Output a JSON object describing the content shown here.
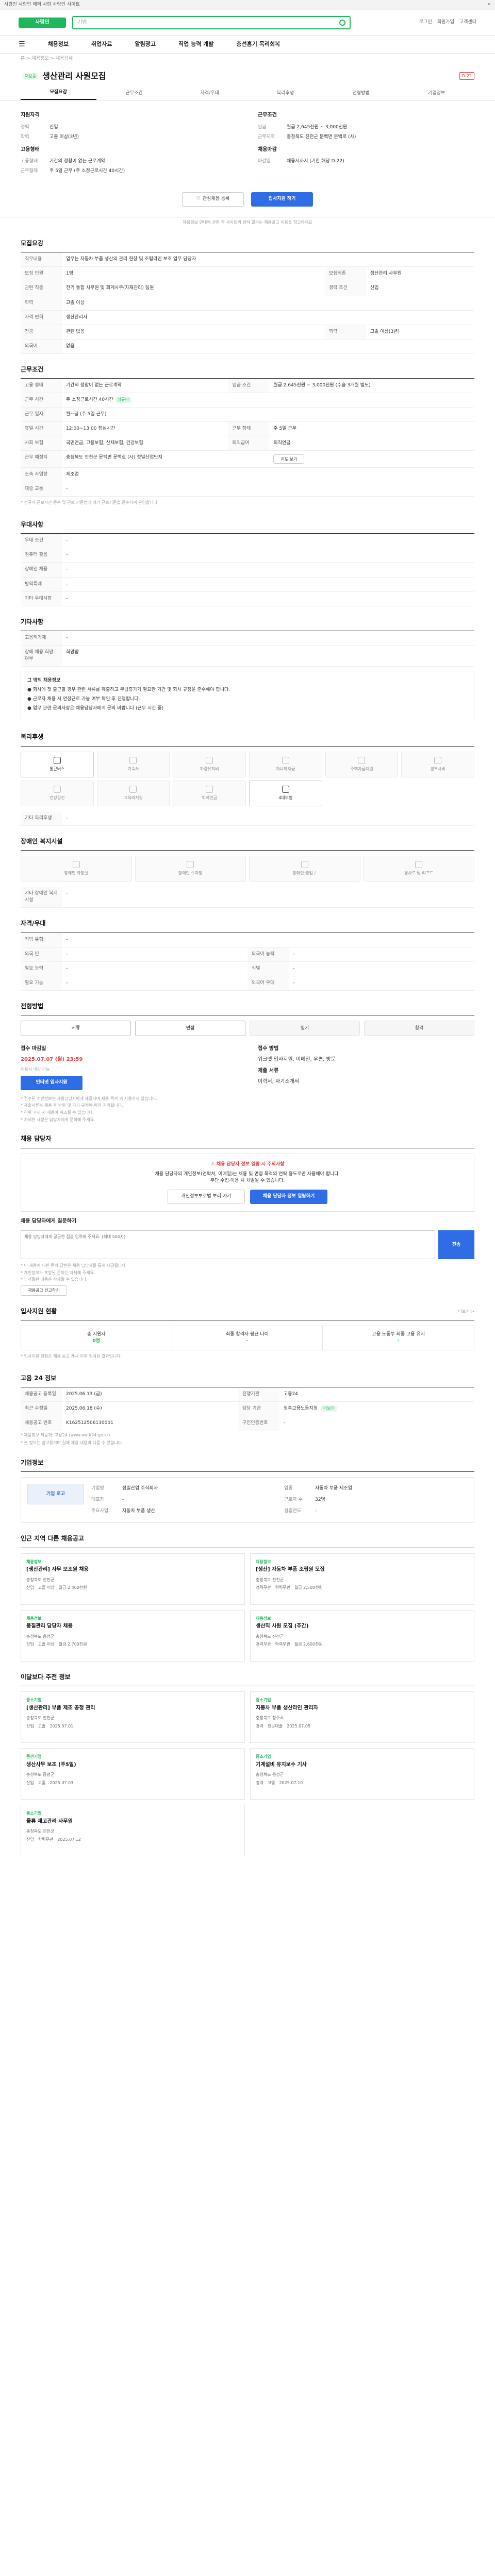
{
  "topbar": {
    "text": "사람인 사람인 해외 사람 사람인 사이트",
    "close": "✕"
  },
  "header": {
    "logo": "사람인",
    "search_placeholder": "기업",
    "links": [
      "로그인",
      "회원가입",
      "고객센터"
    ]
  },
  "nav": {
    "items": [
      "채용정보",
      "취업자료",
      "알림광고",
      "직업 능력 개발",
      "충선흥기 목리회복"
    ]
  },
  "crumb": "홈 > 채용정보 > 채용상세",
  "job": {
    "badge": "채용중",
    "title": "생산관리 사원모집",
    "tag": "D-22"
  },
  "tabs": [
    "모집요강",
    "근무조건",
    "자격/우대",
    "복리후생",
    "전형방법",
    "기업정보"
  ],
  "summary": {
    "left": {
      "h1": "지원자격",
      "rows": [
        {
          "k": "경력",
          "v": "신입"
        },
        {
          "k": "학력",
          "v": "고졸 이상(3년)"
        }
      ],
      "h2": "고용형태",
      "rows2": [
        {
          "k": "고용형태",
          "v": "기간의 정함이 없는 근로계약"
        },
        {
          "k": "근무형태",
          "v": "주 5일 근무 (주 소정근로시간 40시간)"
        }
      ]
    },
    "right": {
      "h1": "근무조건",
      "rows": [
        {
          "k": "임금",
          "v": "월급 2,645천원 ~ 3,000천원"
        },
        {
          "k": "근무지역",
          "v": "충청북도 진천군 문백면 문백로 (사)"
        }
      ],
      "h2": "채용마감",
      "rows2": [
        {
          "k": "마감일",
          "v": "채용시까지 (기한 해당 D-22)"
        }
      ]
    }
  },
  "actions": {
    "scrap": "관심채용 등록",
    "apply": "입사지원 하기",
    "note": "채용정보 안내에 관한 각 사이트의 법적 결과는 채용공고 내용을 참고하세요"
  },
  "recruit": {
    "title": "모집요강",
    "h_work": "직무내용",
    "work_text": "업무는 자동차 부품 생산의 관리 현장 및 조립라인 보조 업무 담당자",
    "rows": [
      {
        "k": "모집 인원",
        "v": "1명",
        "k2": "모집직종",
        "v2": "생산관리 사무원"
      },
      {
        "k": "관련 직종",
        "v": "전기 통합 사무원 및 회계사무(자재관리) 팀원",
        "k2": "경력 조건",
        "v2": "신입"
      },
      {
        "k": "학력",
        "v": "고졸 이상",
        "k2": "",
        "v2": ""
      },
      {
        "k": "자격 면허",
        "v": "생산관리사",
        "k2": "",
        "v2": ""
      },
      {
        "k": "전공",
        "v": "관련 없음",
        "k2": "학력",
        "v2": "고졸 이상(3년)"
      },
      {
        "k": "외국어",
        "v": "없음",
        "k2": "",
        "v2": ""
      }
    ]
  },
  "conditions": {
    "title": "근무조건",
    "rows": [
      {
        "k": "고용 형태",
        "v": "기간의 정함이 없는 근로계약",
        "k2": "임금 조건",
        "v2": "월급 2,645천원 ~ 3,000천원 (수습 3개월 별도)"
      },
      {
        "k": "근무 시간",
        "v": "주 소정근로시간 40시간",
        "k2": "",
        "v2": ""
      },
      {
        "k": "근무 일자",
        "v": "월~금 (주 5일 근무)",
        "k2": "",
        "v2": ""
      },
      {
        "k": "휴일 시간",
        "v": "12:00~13:00 점심시간",
        "k2": "근무 형태",
        "v2": "주 5일 근무"
      },
      {
        "k": "사회 보험",
        "v": "국민연금, 고용보험, 산재보험, 건강보험",
        "k2": "퇴직급여",
        "v2": "퇴직연금"
      },
      {
        "k": "근무 예정지",
        "v": "충청북도 진천군 문백면 문백로 (사) 정밀산업단지",
        "k2": "",
        "v2": ""
      },
      {
        "k": "소속 사업장",
        "v": "제조업",
        "k2": "",
        "v2": ""
      },
      {
        "k": "대중 교통",
        "v": "-",
        "k2": "",
        "v2": ""
      }
    ],
    "badge": "정규직",
    "map_button": "지도 보기",
    "note": "* 정규직 근로시간 준수 및 근로 기준법에 의거 근로기준을 준수하며 운영합니다"
  },
  "preference": {
    "title": "우대사항",
    "rows": [
      {
        "k": "우대 조건",
        "v": "-"
      },
      {
        "k": "컴퓨터 활용",
        "v": "-"
      },
      {
        "k": "장애인 채용",
        "v": "-"
      },
      {
        "k": "병역특례",
        "v": "-"
      },
      {
        "k": "기타 우대사항",
        "v": "-"
      }
    ]
  },
  "other": {
    "title": "기타사항",
    "rows": [
      {
        "k": "고용허가제",
        "v": "-"
      },
      {
        "k": "장애 채용 희망 여부",
        "v": "희망함"
      }
    ],
    "box_title": "그 밖의 채용정보",
    "box_lines": [
      "● 회사에 첫 출근할 경우 관련 서류를 제출하고 무급휴가가 필요한 기간 및 회사 규정을 준수해야 합니다.",
      "● 근로자 채용 시 연장근로 가능 여부 확인 후 진행합니다.",
      "● 업무 관련 문의사항은 채용담당자에게 문의 바랍니다 (근무 시간 중)"
    ]
  },
  "welfare": {
    "title": "복리후생",
    "items": [
      {
        "label": "통근버스",
        "on": true
      },
      {
        "label": "기숙사",
        "on": false
      },
      {
        "label": "차량유지비",
        "on": false
      },
      {
        "label": "자녀학자금",
        "on": false
      },
      {
        "label": "주택자금지원",
        "on": false
      },
      {
        "label": "경조사비",
        "on": false
      },
      {
        "label": "건강검진",
        "on": false
      },
      {
        "label": "교육비지원",
        "on": false
      },
      {
        "label": "퇴직연금",
        "on": false
      },
      {
        "label": "4대보험",
        "on": true
      }
    ],
    "etc_k": "기타 복리후생",
    "etc_v": "-"
  },
  "disability": {
    "title": "장애인 복지시설",
    "items": [
      {
        "label": "장애인 화장실"
      },
      {
        "label": "장애인 주차장"
      },
      {
        "label": "장애인 출입구"
      },
      {
        "label": "경사로 및 리프트"
      }
    ],
    "etc_k": "기타 장애인 복지시설",
    "etc_v": "-"
  },
  "worker": {
    "title": "자격/우대",
    "rows": [
      {
        "k": "직업 유형",
        "v": "-"
      },
      {
        "k": "외국 인",
        "v": "-",
        "k2": "외국어 능력",
        "v2": "-"
      },
      {
        "k": "필요 능력",
        "v": "-",
        "k2": "식별",
        "v2": "-"
      },
      {
        "k": "필요 기능",
        "v": "-",
        "k2": "외국어 우대",
        "v2": "-"
      }
    ]
  },
  "process": {
    "title": "전형방법",
    "steps": [
      {
        "label": "서류",
        "on": true
      },
      {
        "label": "면접",
        "on": true
      },
      {
        "label": "필기",
        "on": false
      },
      {
        "label": "합격",
        "on": false
      }
    ],
    "apply_h": "접수 마감일",
    "apply_date": "2025.07.07 (월) 23:59",
    "apply_sub": "채용시 마감 가능",
    "apply_btn": "인터넷 입사지원",
    "method_h": "접수 방법",
    "method_v": "워크넷 입사지원, 이메일, 우편, 방문",
    "docs_h": "제출 서류",
    "docs_v": "이력서, 자기소개서",
    "notes": [
      "* 접수된 개인정보는 채용담당자에게 제공되며 채용 목적 외 사용하지 않습니다.",
      "* 제출서류는 채용 후 반환 및 파기 규정에 따라 처리됩니다.",
      "* 허위 기재 시 채용이 취소될 수 있습니다.",
      "* 자세한 사항은 담당자에게 문의해 주세요."
    ]
  },
  "contact": {
    "title": "채용 담당자",
    "warn": "채용 담당자 정보 열람 시 주의사항",
    "lines": [
      "채용 담당자의 개인정보(연락처, 이메일)는 채용 및 면접 목적의 연락 용도로만 사용해야 합니다.",
      "무단 수집·이용 시 처벌될 수 있습니다."
    ],
    "btn1": "개인정보보호법 보러 가기",
    "btn2": "채용 담당자 정보 열람하기",
    "inquiry_h": "채용 담당자에게 질문하기",
    "inquiry_ph": "채용 담당자에게 궁금한 점을 입력해 주세요. (최대 500자)",
    "send": "전송",
    "notes": [
      "* 이 채용에 대한 문의 답변은 채용 담당자를 통해 제공됩니다.",
      "* 개인정보가 포함된 문의는 자제해 주세요.",
      "* 부적절한 내용은 삭제될 수 있습니다."
    ],
    "report": "채용공고 신고하기"
  },
  "apply_stats": {
    "title": "입사지원 현황",
    "more": "더보기 >",
    "items": [
      {
        "label": "총 지원자",
        "value": "0명"
      },
      {
        "label": "최종 합격자 평균 나이",
        "value": "-"
      },
      {
        "label": "고용 노동부 최종 고용 유지",
        "value": "-"
      }
    ],
    "note": "* 입사지원 현황은 채용 공고 게시 이후 집계된 결과입니다."
  },
  "gov": {
    "title": "고용 24 정보",
    "rows": [
      {
        "k": "채용공고 등록일",
        "v": "2025.06.13 (금)",
        "k2": "진행기관",
        "v2": "고용24"
      },
      {
        "k": "최근 수정일",
        "v": "2025.06.18 (수)",
        "k2": "담당 기관",
        "v2": "청주고용노동지청"
      },
      {
        "k": "채용공고 번호",
        "v": "K162512506130001",
        "k2": "구인인증번호",
        "v2": "-"
      }
    ],
    "badge": "더보기",
    "notes": [
      "* 채용정보 제공처: 고용24 (www.work24.go.kr)",
      "* 본 정보는 참고용이며 실제 채용 내용과 다를 수 있습니다."
    ]
  },
  "company": {
    "title": "기업정보",
    "logo": "기업 로고",
    "rows": [
      {
        "k": "기업명",
        "v": "정밀산업 주식회사"
      },
      {
        "k": "업종",
        "v": "자동차 부품 제조업"
      },
      {
        "k": "대표자",
        "v": "-"
      },
      {
        "k": "근로자 수",
        "v": "32명"
      },
      {
        "k": "주요사업",
        "v": "자동차 부품 생산"
      },
      {
        "k": "설립연도",
        "v": "-"
      }
    ]
  },
  "related": {
    "title": "인근 지역 다른 채용공고",
    "cards": [
      {
        "co": "채용정보",
        "title": "[생산관리] 사무 보조원 채용",
        "meta": "충청북도 진천군",
        "r1": "신입",
        "r2": "고졸 이상",
        "r3": "월급 2,400천원"
      },
      {
        "co": "채용정보",
        "title": "[생산] 자동차 부품 조립원 모집",
        "meta": "충청북도 진천군",
        "r1": "경력무관",
        "r2": "학력무관",
        "r3": "월급 2,500천원"
      },
      {
        "co": "채용정보",
        "title": "품질관리 담당자 채용",
        "meta": "충청북도 음성군",
        "r1": "신입",
        "r2": "고졸 이상",
        "r3": "월급 2,700천원"
      },
      {
        "co": "채용정보",
        "title": "생산직 사원 모집 (주간)",
        "meta": "충청북도 진천군",
        "r1": "경력무관",
        "r2": "학력무관",
        "r3": "월급 2,600천원"
      }
    ]
  },
  "nearby": {
    "title": "이달보다 주전 정보",
    "cards": [
      {
        "co": "중소기업",
        "title": "[생산관리] 부품 제조 공정 관리",
        "meta": "충청북도 진천군",
        "r1": "신입",
        "r2": "고졸",
        "r3": "2025.07.01"
      },
      {
        "co": "중소기업",
        "title": "자동차 부품 생산라인 관리자",
        "meta": "충청북도 청주시",
        "r1": "경력",
        "r2": "전문대졸",
        "r3": "2025.07.05"
      },
      {
        "co": "중견기업",
        "title": "생산사무 보조 (주5일)",
        "meta": "충청북도 증평군",
        "r1": "신입",
        "r2": "고졸",
        "r3": "2025.07.03"
      },
      {
        "co": "중소기업",
        "title": "기계설비 유지보수 기사",
        "meta": "충청북도 음성군",
        "r1": "경력",
        "r2": "고졸",
        "r3": "2025.07.10"
      },
      {
        "co": "중소기업",
        "title": "물류 재고관리 사무원",
        "meta": "충청북도 진천군",
        "r1": "신입",
        "r2": "학력무관",
        "r3": "2025.07.12"
      }
    ]
  }
}
